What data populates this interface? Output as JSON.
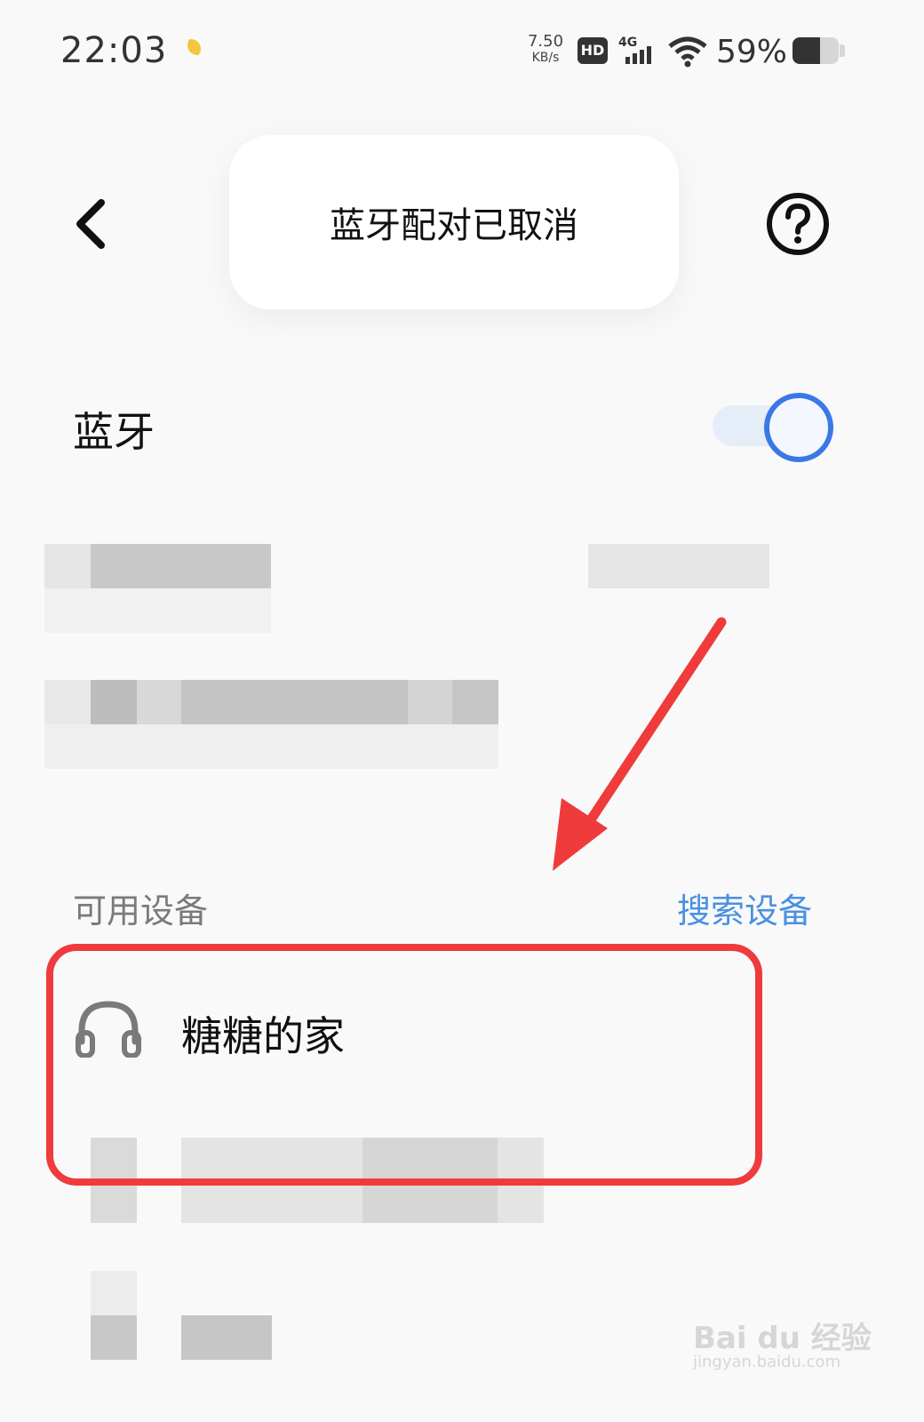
{
  "status_bar": {
    "time": "22:03",
    "net_speed_value": "7.50",
    "net_speed_unit": "KB/s",
    "hd_badge": "HD",
    "network_type": "4G",
    "battery_percent": "59%",
    "battery_level": 0.59,
    "icons": [
      "moon-icon",
      "hd-icon",
      "signal-icon",
      "wifi-icon",
      "battery-icon"
    ]
  },
  "header": {
    "back_icon": "chevron-left-icon",
    "toast_text": "蓝牙配对已取消",
    "help_icon": "help-circle-icon"
  },
  "bluetooth": {
    "label": "蓝牙",
    "enabled": true
  },
  "available_devices": {
    "section_label": "可用设备",
    "search_label": "搜索设备",
    "devices": [
      {
        "name": "糖糖的家",
        "icon": "headphones-icon"
      }
    ]
  },
  "colors": {
    "accent": "#3b78e7",
    "link": "#4a90e2",
    "annotation": "#ef3b3b"
  },
  "watermark": {
    "logo": "Bai du 经验",
    "url": "jingyan.baidu.com"
  }
}
